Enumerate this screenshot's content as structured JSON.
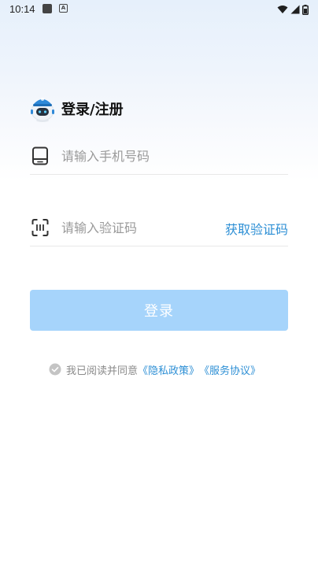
{
  "status_bar": {
    "time": "10:14",
    "notif_a": "A",
    "icons": [
      "wifi-icon",
      "signal-icon",
      "battery-icon"
    ]
  },
  "header": {
    "title": "登录/注册",
    "logo": "robot-mascot-icon"
  },
  "phone_field": {
    "placeholder": "请输入手机号码",
    "value": "",
    "icon": "phone-icon"
  },
  "code_field": {
    "placeholder": "请输入验证码",
    "value": "",
    "icon": "scan-code-icon",
    "get_code_label": "获取验证码"
  },
  "login_button": {
    "label": "登录"
  },
  "agreement": {
    "prefix": "我已阅读并同意",
    "privacy_link": "《隐私政策》",
    "service_link": "《服务协议》",
    "icon": "check-circle-icon"
  },
  "colors": {
    "accent": "#2d8fd5",
    "button_disabled": "#a6d4fb",
    "placeholder": "#9a9a9a"
  }
}
